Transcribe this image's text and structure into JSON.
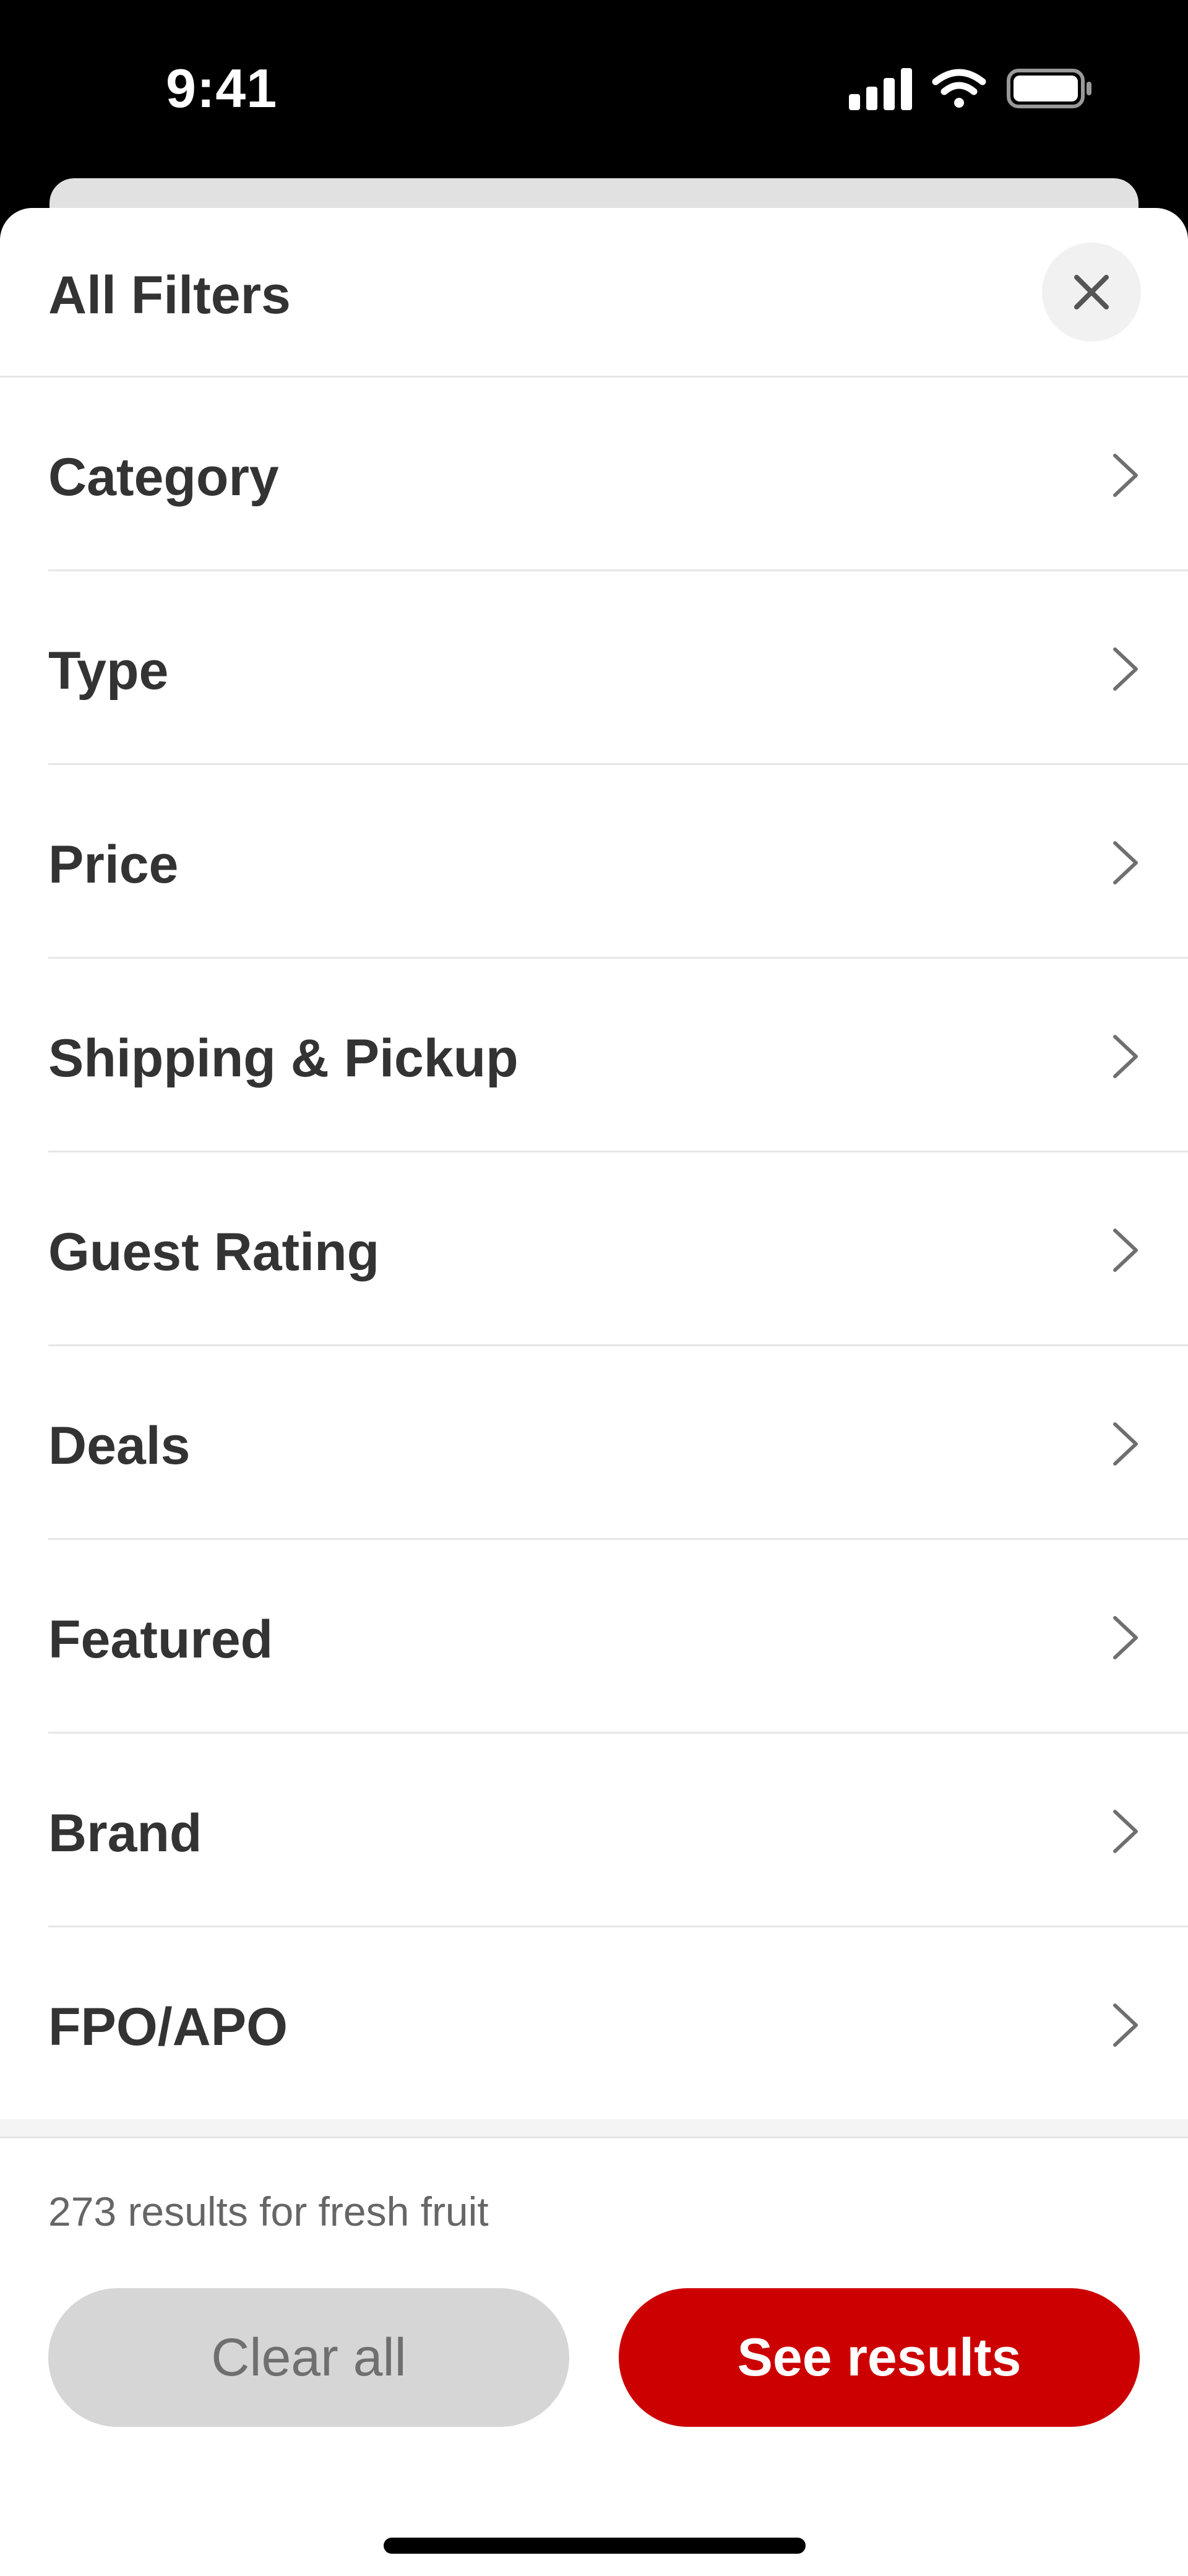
{
  "status_bar": {
    "time": "9:41",
    "icons": [
      "cellular-signal-icon",
      "wifi-icon",
      "battery-icon"
    ]
  },
  "sheet": {
    "title": "All Filters",
    "close_icon": "close-icon"
  },
  "filters": [
    {
      "label": "Category"
    },
    {
      "label": "Type"
    },
    {
      "label": "Price"
    },
    {
      "label": "Shipping & Pickup"
    },
    {
      "label": "Guest Rating"
    },
    {
      "label": "Deals"
    },
    {
      "label": "Featured"
    },
    {
      "label": "Brand"
    },
    {
      "label": "FPO/APO"
    }
  ],
  "footer": {
    "results_text": "273 results for fresh fruit",
    "clear_label": "Clear all",
    "see_results_label": "See results"
  },
  "colors": {
    "accent": "#cc0000",
    "text_primary": "#333333",
    "button_disabled": "#d6d6d6"
  }
}
